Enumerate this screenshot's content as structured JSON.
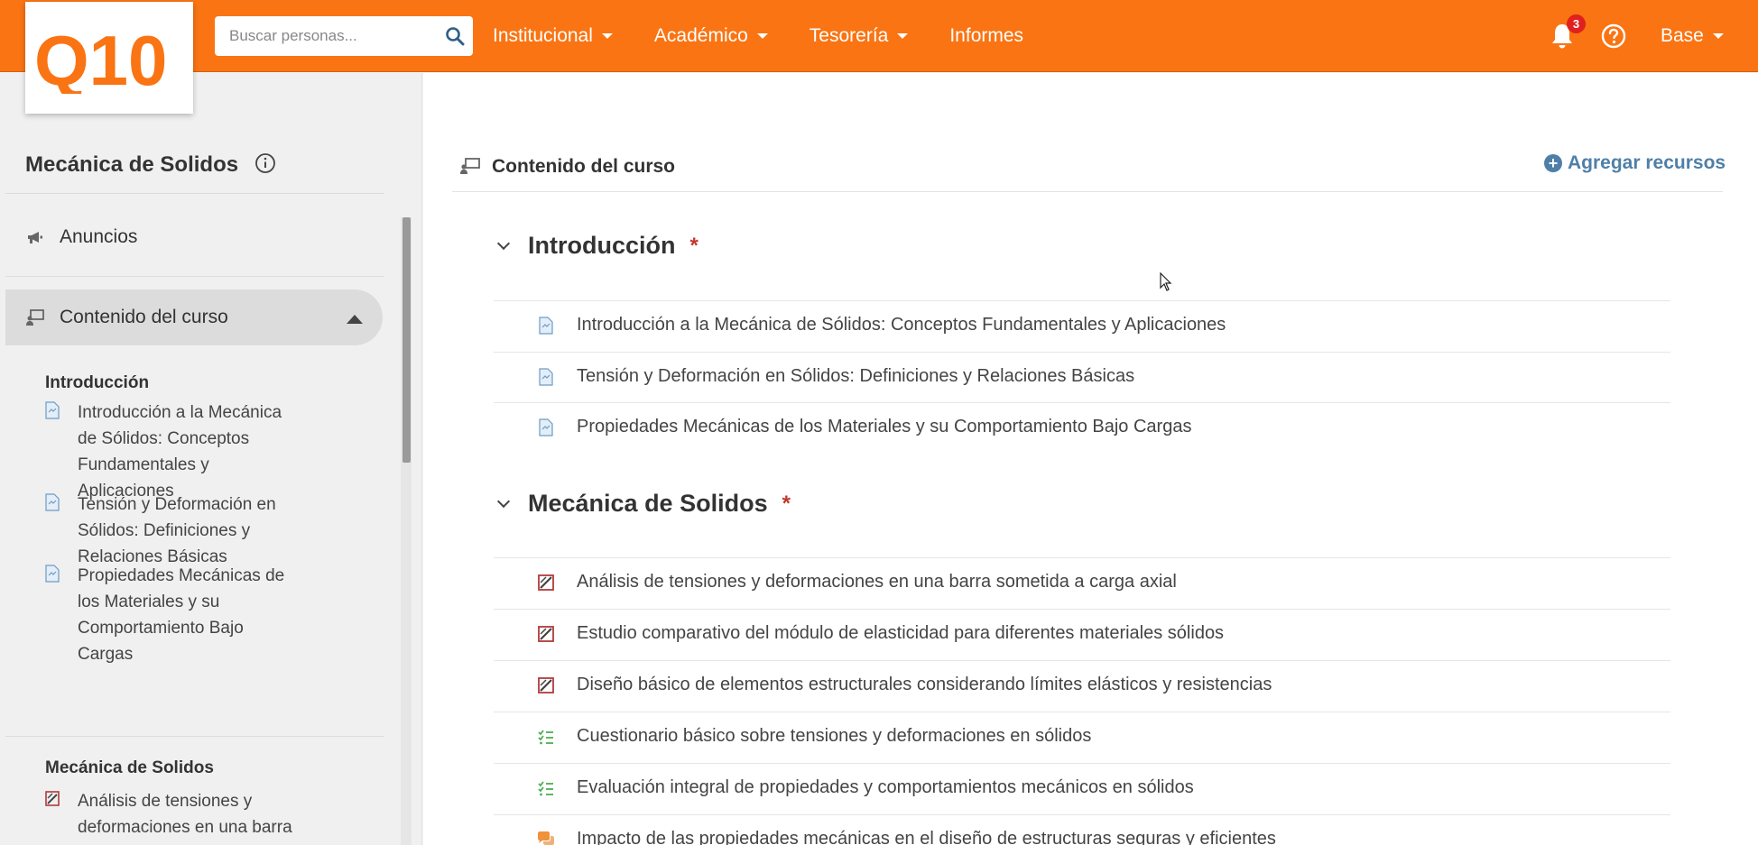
{
  "app": {
    "logo_text": "Q10",
    "logo_icon": "q10-logo",
    "accent_color": "#fa7413"
  },
  "header": {
    "search_placeholder": "Buscar personas...",
    "nav": [
      {
        "label": "Institucional",
        "has_dropdown": true
      },
      {
        "label": "Académico",
        "has_dropdown": true
      },
      {
        "label": "Tesorería",
        "has_dropdown": true
      },
      {
        "label": "Informes",
        "has_dropdown": false
      }
    ],
    "notifications_count": "3",
    "user_menu_label": "Base"
  },
  "sidebar": {
    "course_title": "Mecánica de Solidos",
    "announcements_label": "Anuncios",
    "content_label": "Contenido del curso",
    "sections": [
      {
        "title": "Introducción",
        "items": [
          {
            "label": "Introducción a la Mecánica de Sólidos: Conceptos Fundamentales y Aplicaciones",
            "icon": "document-icon"
          },
          {
            "label": "Tensión y Deformación en Sólidos: Definiciones y Relaciones Básicas",
            "icon": "document-icon"
          },
          {
            "label": "Propiedades Mecánicas de los Materiales y su Comportamiento Bajo Cargas",
            "icon": "document-icon"
          }
        ]
      },
      {
        "title": "Mecánica de Solidos",
        "items": [
          {
            "label": "Análisis de tensiones y deformaciones en una barra",
            "icon": "assignment-icon"
          }
        ]
      }
    ]
  },
  "main": {
    "header_label": "Contenido del curso",
    "add_resources_label": "Agregar recursos",
    "sections": [
      {
        "title": "Introducción",
        "required_mark": "*",
        "items": [
          {
            "label": "Introducción a la Mecánica de Sólidos: Conceptos Fundamentales y Aplicaciones",
            "icon": "document-icon"
          },
          {
            "label": "Tensión y Deformación en Sólidos: Definiciones y Relaciones Básicas",
            "icon": "document-icon"
          },
          {
            "label": "Propiedades Mecánicas de los Materiales y su Comportamiento Bajo Cargas",
            "icon": "document-icon"
          }
        ]
      },
      {
        "title": "Mecánica de Solidos",
        "required_mark": "*",
        "items": [
          {
            "label": "Análisis de tensiones y deformaciones en una barra sometida a carga axial",
            "icon": "assignment-icon"
          },
          {
            "label": "Estudio comparativo del módulo de elasticidad para diferentes materiales sólidos",
            "icon": "assignment-icon"
          },
          {
            "label": "Diseño básico de elementos estructurales considerando límites elásticos y resistencias",
            "icon": "assignment-icon"
          },
          {
            "label": "Cuestionario básico sobre tensiones y deformaciones en sólidos",
            "icon": "quiz-icon"
          },
          {
            "label": "Evaluación integral de propiedades y comportamientos mecánicos en sólidos",
            "icon": "quiz-icon"
          },
          {
            "label": "Impacto de las propiedades mecánicas en el diseño de estructuras seguras y eficientes",
            "icon": "forum-icon"
          }
        ]
      }
    ]
  }
}
